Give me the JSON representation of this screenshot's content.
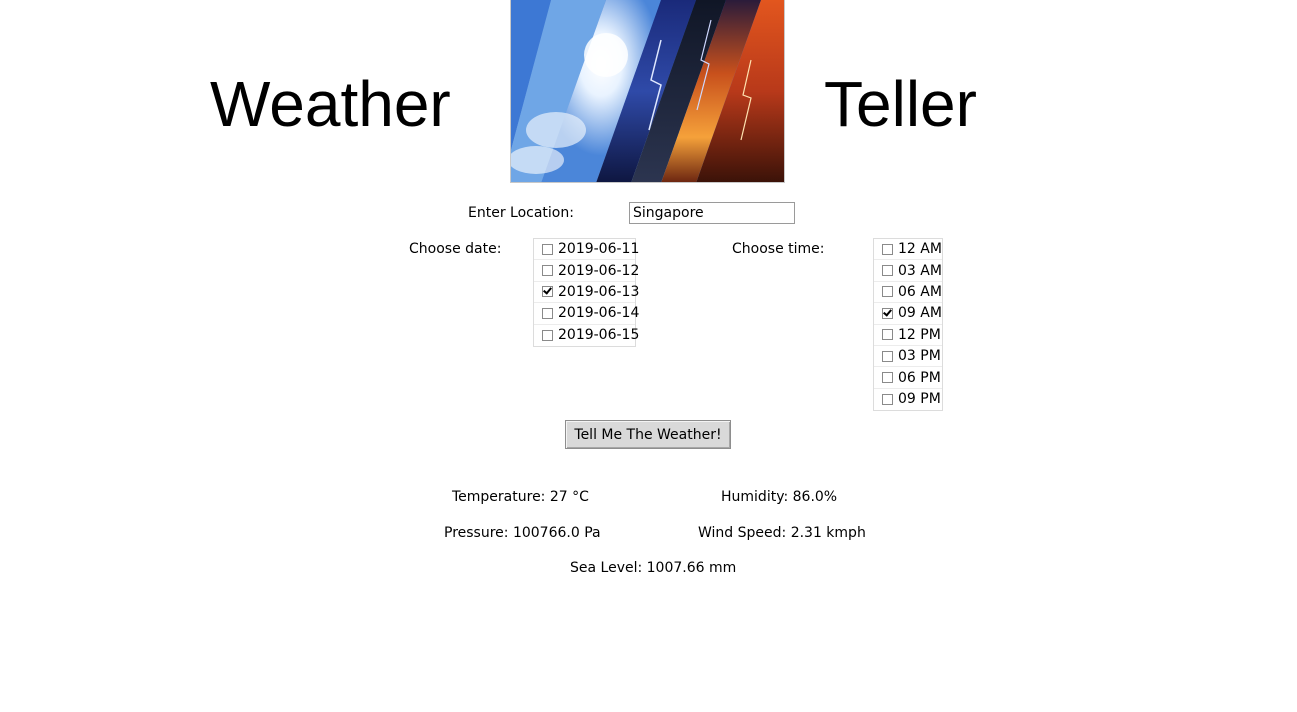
{
  "header": {
    "title_left": "Weather",
    "title_right": "Teller",
    "logo_icon": "weather-collage-image"
  },
  "location": {
    "label": "Enter Location:",
    "value": "Singapore"
  },
  "date": {
    "label": "Choose date:",
    "options": [
      {
        "label": "2019-06-11",
        "checked": false
      },
      {
        "label": "2019-06-12",
        "checked": false
      },
      {
        "label": "2019-06-13",
        "checked": true
      },
      {
        "label": "2019-06-14",
        "checked": false
      },
      {
        "label": "2019-06-15",
        "checked": false
      }
    ]
  },
  "time": {
    "label": "Choose time:",
    "options": [
      {
        "label": "12 AM",
        "checked": false
      },
      {
        "label": "03 AM",
        "checked": false
      },
      {
        "label": "06 AM",
        "checked": false
      },
      {
        "label": "09 AM",
        "checked": true
      },
      {
        "label": "12 PM",
        "checked": false
      },
      {
        "label": "03 PM",
        "checked": false
      },
      {
        "label": "06 PM",
        "checked": false
      },
      {
        "label": "09 PM",
        "checked": false
      }
    ]
  },
  "action": {
    "button_label": "Tell Me The Weather!"
  },
  "results": {
    "temperature": "Temperature:  27 °C",
    "humidity": "Humidity:  86.0%",
    "pressure": "Pressure:  100766.0 Pa",
    "wind_speed": "Wind Speed:  2.31 kmph",
    "sea_level": "Sea Level:  1007.66 mm"
  }
}
